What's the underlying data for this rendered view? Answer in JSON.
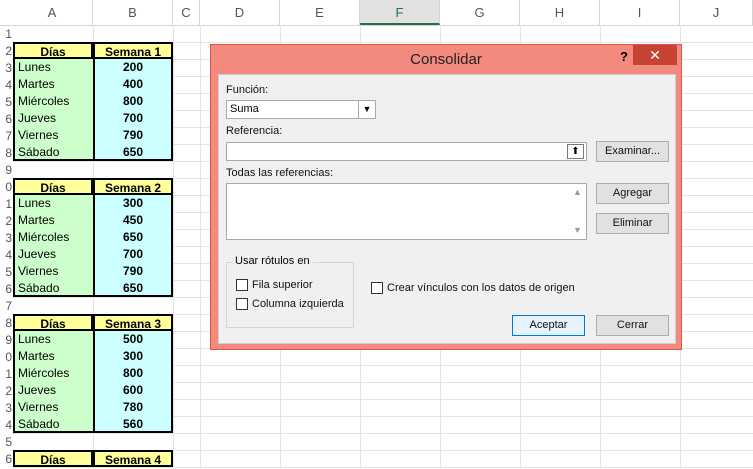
{
  "spreadsheet": {
    "columns": [
      "A",
      "B",
      "C",
      "D",
      "E",
      "F",
      "G",
      "H",
      "I",
      "J"
    ],
    "selected_column": "F",
    "row_numbers": [
      "1",
      "2",
      "3",
      "4",
      "5",
      "6",
      "7",
      "8",
      "9",
      "0",
      "1",
      "2",
      "3",
      "4",
      "5",
      "6",
      "7",
      "8",
      "9",
      "0",
      "1",
      "2",
      "3",
      "4",
      "5",
      "6"
    ],
    "tables": [
      {
        "header_a": "Días",
        "header_b": "Semana 1",
        "rows": [
          [
            "Lunes",
            "200"
          ],
          [
            "Martes",
            "400"
          ],
          [
            "Miércoles",
            "800"
          ],
          [
            "Jueves",
            "700"
          ],
          [
            "Viernes",
            "790"
          ],
          [
            "Sábado",
            "650"
          ]
        ]
      },
      {
        "header_a": "Días",
        "header_b": "Semana 2",
        "rows": [
          [
            "Lunes",
            "300"
          ],
          [
            "Martes",
            "450"
          ],
          [
            "Miércoles",
            "650"
          ],
          [
            "Jueves",
            "700"
          ],
          [
            "Viernes",
            "790"
          ],
          [
            "Sábado",
            "650"
          ]
        ]
      },
      {
        "header_a": "Días",
        "header_b": "Semana 3",
        "rows": [
          [
            "Lunes",
            "500"
          ],
          [
            "Martes",
            "300"
          ],
          [
            "Miércoles",
            "800"
          ],
          [
            "Jueves",
            "600"
          ],
          [
            "Viernes",
            "780"
          ],
          [
            "Sábado",
            "560"
          ]
        ]
      },
      {
        "header_a": "Días",
        "header_b": "Semana 4",
        "rows": []
      }
    ]
  },
  "dialog": {
    "title": "Consolidar",
    "help": "?",
    "close": "✕",
    "function_label": "Función:",
    "function_value": "Suma",
    "reference_label": "Referencia:",
    "reference_value": "",
    "browse_button": "Examinar...",
    "all_refs_label": "Todas las referencias:",
    "add_button": "Agregar",
    "delete_button": "Eliminar",
    "use_labels_group": "Usar rótulos en",
    "top_row": "Fila superior",
    "left_column": "Columna izquierda",
    "create_links": "Crear vínculos con los datos de origen",
    "ok_button": "Aceptar",
    "close_button": "Cerrar",
    "colors": {
      "title_bar": "#f38a7e",
      "close_bg": "#c74434",
      "body": "#f0f0f0"
    }
  }
}
